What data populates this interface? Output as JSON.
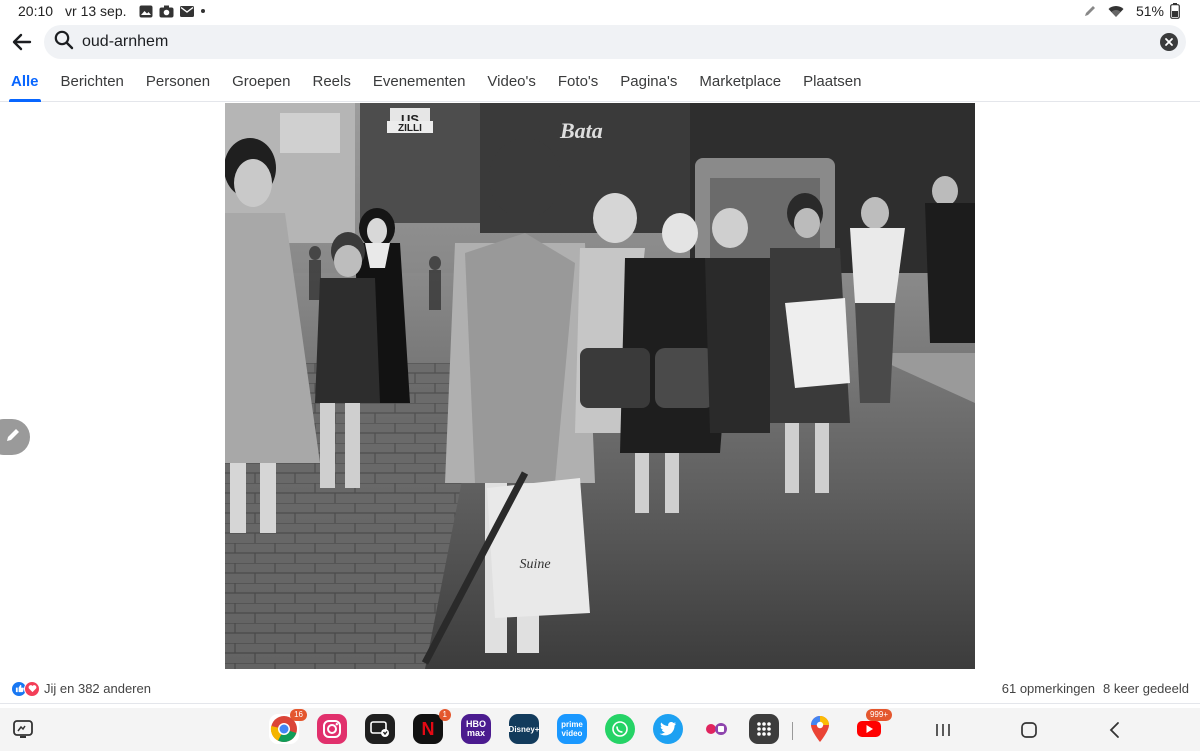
{
  "status_bar": {
    "time": "20:10",
    "date": "vr 13 sep.",
    "battery": "51%",
    "icons": [
      "gallery-icon",
      "camera-icon",
      "mail-icon",
      "dot-icon",
      "pen-icon",
      "wifi-icon",
      "battery-icon"
    ]
  },
  "search": {
    "query": "oud-arnhem"
  },
  "tabs": [
    {
      "label": "Alle",
      "active": true
    },
    {
      "label": "Berichten"
    },
    {
      "label": "Personen"
    },
    {
      "label": "Groepen"
    },
    {
      "label": "Reels"
    },
    {
      "label": "Evenementen"
    },
    {
      "label": "Video's"
    },
    {
      "label": "Foto's"
    },
    {
      "label": "Pagina's"
    },
    {
      "label": "Marketplace"
    },
    {
      "label": "Plaatsen"
    }
  ],
  "post": {
    "reactions_text": "Jij en 382 anderen",
    "comments": "61 opmerkingen",
    "shares": "8 keer gedeeld",
    "photo": {
      "signs": [
        "US",
        "ZILLI",
        "Bata",
        "Suine"
      ]
    }
  },
  "dock": {
    "apps": [
      {
        "name": "chrome-icon",
        "badge": "16"
      },
      {
        "name": "instagram-icon",
        "badge": ""
      },
      {
        "name": "screen-recorder-icon",
        "badge": ""
      },
      {
        "name": "netflix-icon",
        "badge": "1",
        "label": "N"
      },
      {
        "name": "hbo-max-icon",
        "badge": "",
        "label": "HBO max"
      },
      {
        "name": "disney-plus-icon",
        "badge": "",
        "label": "Disney+"
      },
      {
        "name": "prime-video-icon",
        "badge": "",
        "label": "prime video"
      },
      {
        "name": "whatsapp-icon",
        "badge": ""
      },
      {
        "name": "twitter-icon",
        "badge": ""
      },
      {
        "name": "app-pair-icon",
        "badge": ""
      },
      {
        "name": "app-grid-icon",
        "badge": ""
      },
      {
        "name": "maps-icon",
        "badge": ""
      },
      {
        "name": "youtube-icon",
        "badge": "999+"
      }
    ]
  },
  "colors": {
    "accent": "#0866ff",
    "search_bg": "#f0f2f5"
  }
}
